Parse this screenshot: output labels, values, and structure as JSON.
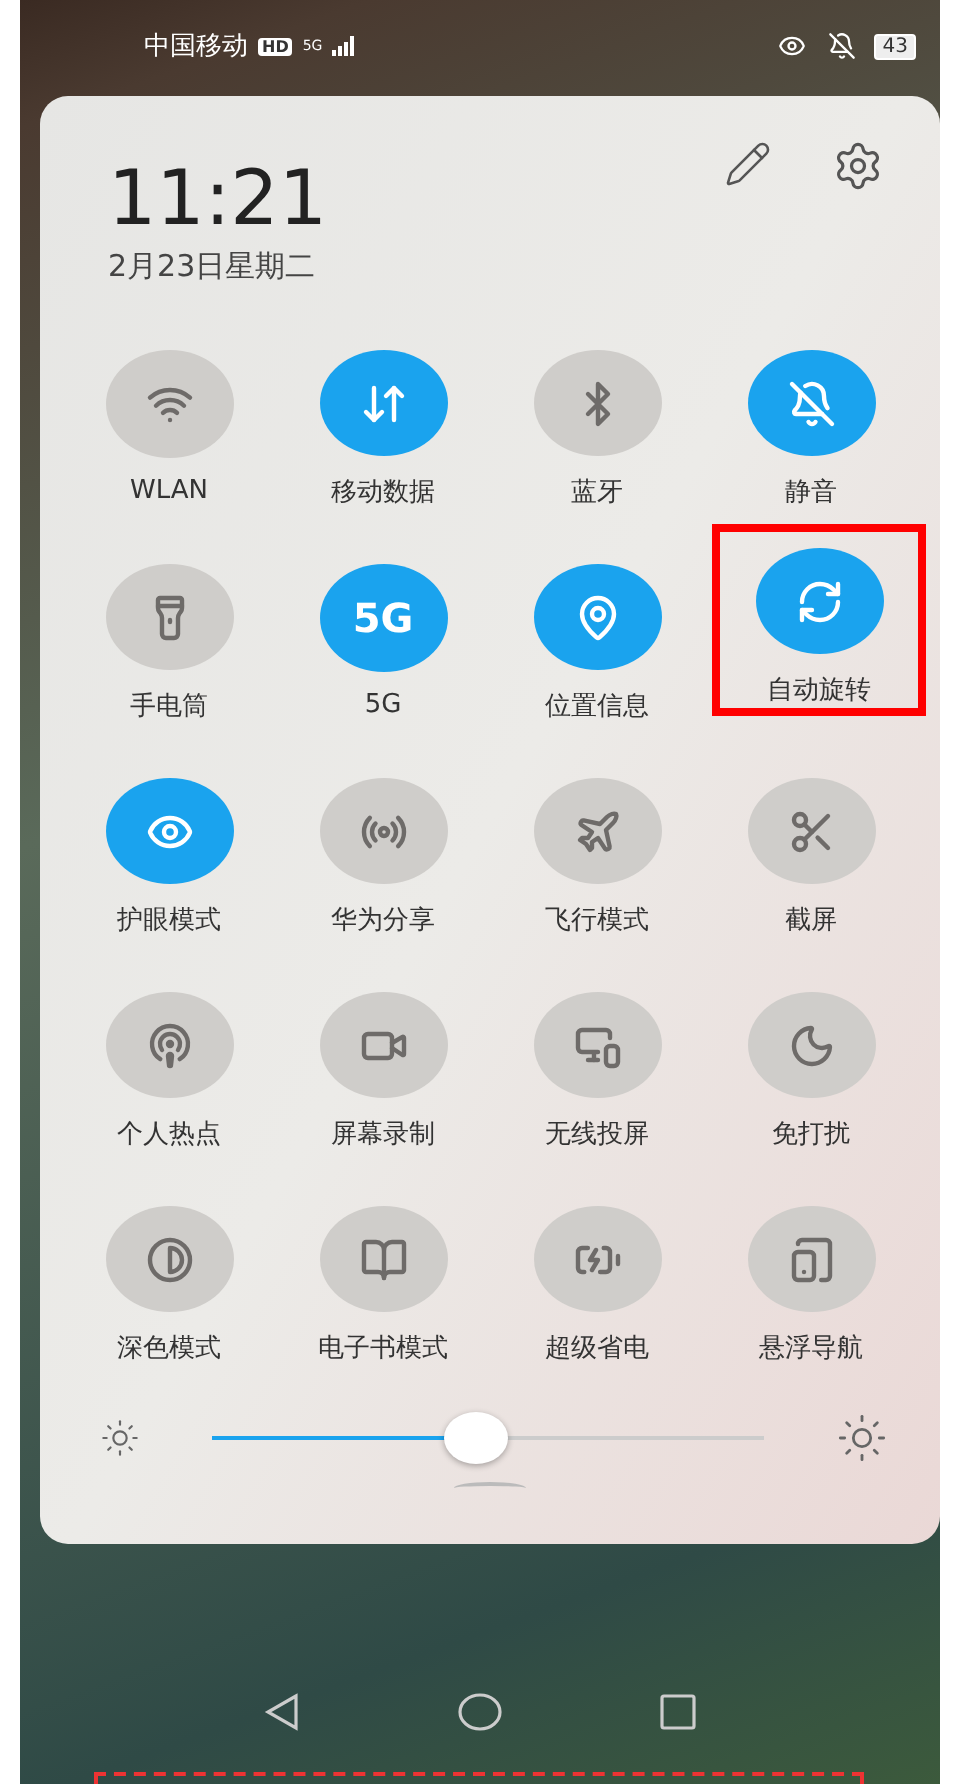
{
  "status_bar": {
    "carrier": "中国移动",
    "hd_badge": "HD",
    "network": "5G",
    "battery": "43"
  },
  "panel": {
    "time": "11:21",
    "date": "2月23日星期二"
  },
  "tiles": [
    {
      "kind": "wifi",
      "label": "WLAN",
      "on": false,
      "highlighted": false
    },
    {
      "kind": "data",
      "label": "移动数据",
      "on": true,
      "highlighted": false
    },
    {
      "kind": "bluetooth",
      "label": "蓝牙",
      "on": false,
      "highlighted": false
    },
    {
      "kind": "mute",
      "label": "静音",
      "on": true,
      "highlighted": false
    },
    {
      "kind": "flashlight",
      "label": "手电筒",
      "on": false,
      "highlighted": false
    },
    {
      "kind": "text",
      "icon_text": "5G",
      "label": "5G",
      "on": true,
      "highlighted": false
    },
    {
      "kind": "location",
      "label": "位置信息",
      "on": true,
      "highlighted": false
    },
    {
      "kind": "rotate",
      "label": "自动旋转",
      "on": true,
      "highlighted": true
    },
    {
      "kind": "eye",
      "label": "护眼模式",
      "on": true,
      "highlighted": false
    },
    {
      "kind": "share",
      "label": "华为分享",
      "on": false,
      "highlighted": false
    },
    {
      "kind": "plane",
      "label": "飞行模式",
      "on": false,
      "highlighted": false
    },
    {
      "kind": "screenshot",
      "label": "截屏",
      "on": false,
      "highlighted": false
    },
    {
      "kind": "hotspot",
      "label": "个人热点",
      "on": false,
      "highlighted": false
    },
    {
      "kind": "record",
      "label": "屏幕录制",
      "on": false,
      "highlighted": false
    },
    {
      "kind": "cast",
      "label": "无线投屏",
      "on": false,
      "highlighted": false
    },
    {
      "kind": "moon",
      "label": "免打扰",
      "on": false,
      "highlighted": false
    },
    {
      "kind": "dark",
      "label": "深色模式",
      "on": false,
      "highlighted": false
    },
    {
      "kind": "book",
      "label": "电子书模式",
      "on": false,
      "highlighted": false
    },
    {
      "kind": "battery",
      "label": "超级省电",
      "on": false,
      "highlighted": false
    },
    {
      "kind": "nav",
      "label": "悬浮导航",
      "on": false,
      "highlighted": false
    }
  ],
  "brightness": {
    "level": 0.48
  }
}
